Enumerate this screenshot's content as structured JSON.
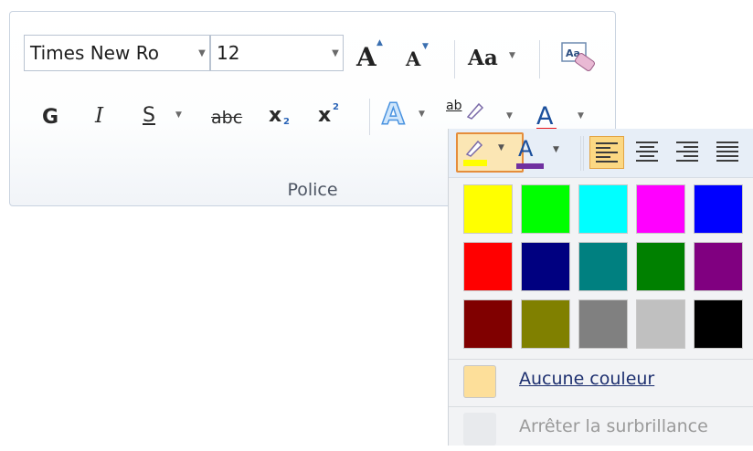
{
  "ribbon": {
    "font_name": "Times New Ro",
    "font_size": "12",
    "grow_font_glyph": "A",
    "shrink_font_glyph": "A",
    "change_case_label": "Aa",
    "bold_label": "G",
    "italic_label": "I",
    "underline_label": "S",
    "strikethrough_label": "abc",
    "subscript_label": "x",
    "subscript_sub": "2",
    "superscript_label": "x",
    "superscript_sup": "2",
    "text_effects_label": "A",
    "highlight_label": "ab",
    "font_color_label": "A",
    "group_label": "Police",
    "font_color_bar": "#e8151b"
  },
  "dropdown": {
    "mini_font_color_label": "A",
    "highlight_bar_color": "#ffff00",
    "font_color_bar": "#7030a0",
    "colors": [
      [
        "#ffff00",
        "#00ff00",
        "#00ffff",
        "#ff00ff",
        "#0000ff"
      ],
      [
        "#ff0000",
        "#000080",
        "#008080",
        "#008000",
        "#800080"
      ],
      [
        "#800000",
        "#808000",
        "#808080",
        "#c0c0c0",
        "#000000"
      ]
    ],
    "no_color_label": "Aucune couleur",
    "stop_highlight_label": "Arrêter la surbrillance"
  }
}
